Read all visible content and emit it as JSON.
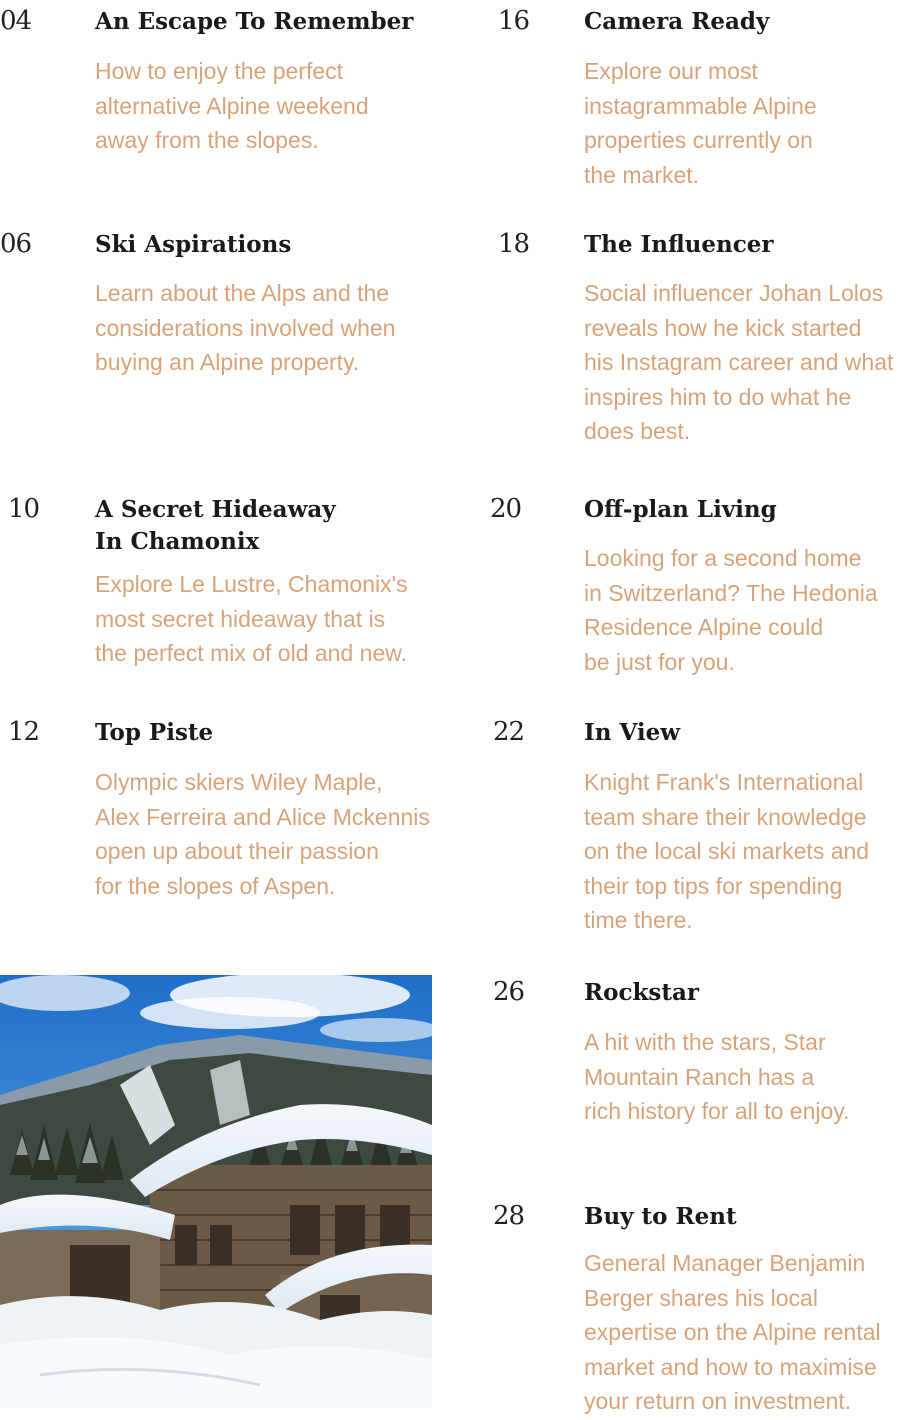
{
  "left_column": [
    {
      "num": "04",
      "title": "An Escape To Remember",
      "desc": "How to enjoy the perfect\nalternative Alpine weekend\naway from the slopes."
    },
    {
      "num": "06",
      "title": "Ski Aspirations",
      "desc": "Learn about the Alps and the\nconsiderations involved when\nbuying an Alpine property."
    },
    {
      "num": "10",
      "title": "A Secret Hideaway\nIn Chamonix",
      "desc": "Explore Le Lustre, Chamonix's\nmost secret hideaway that is\nthe perfect mix of old and new."
    },
    {
      "num": "12",
      "title": "Top Piste",
      "desc": "Olympic skiers Wiley Maple,\nAlex Ferreira and Alice Mckennis\nopen up about their passion\nfor the slopes of Aspen."
    }
  ],
  "right_column": [
    {
      "num": "16",
      "title": "Camera Ready",
      "desc": "Explore our most\ninstagrammable Alpine\nproperties currently on\nthe market."
    },
    {
      "num": "18",
      "title": "The Influencer",
      "desc": "Social influencer Johan Lolos\nreveals how he kick started\nhis Instagram career and what\ninspires him to do what he\ndoes best."
    },
    {
      "num": "20",
      "title": "Off-plan Living",
      "desc": "Looking for a second home\nin Switzerland? The Hedonia\nResidence Alpine could\nbe just for you."
    },
    {
      "num": "22",
      "title": "In View",
      "desc": "Knight Frank's International\nteam share their knowledge\non the local ski markets and\ntheir top tips for spending\ntime there."
    },
    {
      "num": "26",
      "title": "Rockstar",
      "desc": "A hit with the stars, Star\nMountain Ranch has a\nrich history for all to enjoy."
    },
    {
      "num": "28",
      "title": "Buy to Rent",
      "desc": "General Manager Benjamin\nBerger shares his local\nexpertise on the Alpine rental\nmarket and how to maximise\nyour return on investment."
    }
  ],
  "colors": {
    "heading": "#1a1a1a",
    "number": "#222222",
    "description": "#d9a37a"
  },
  "photo": {
    "subject": "snow-covered alpine chalets under blue sky"
  }
}
